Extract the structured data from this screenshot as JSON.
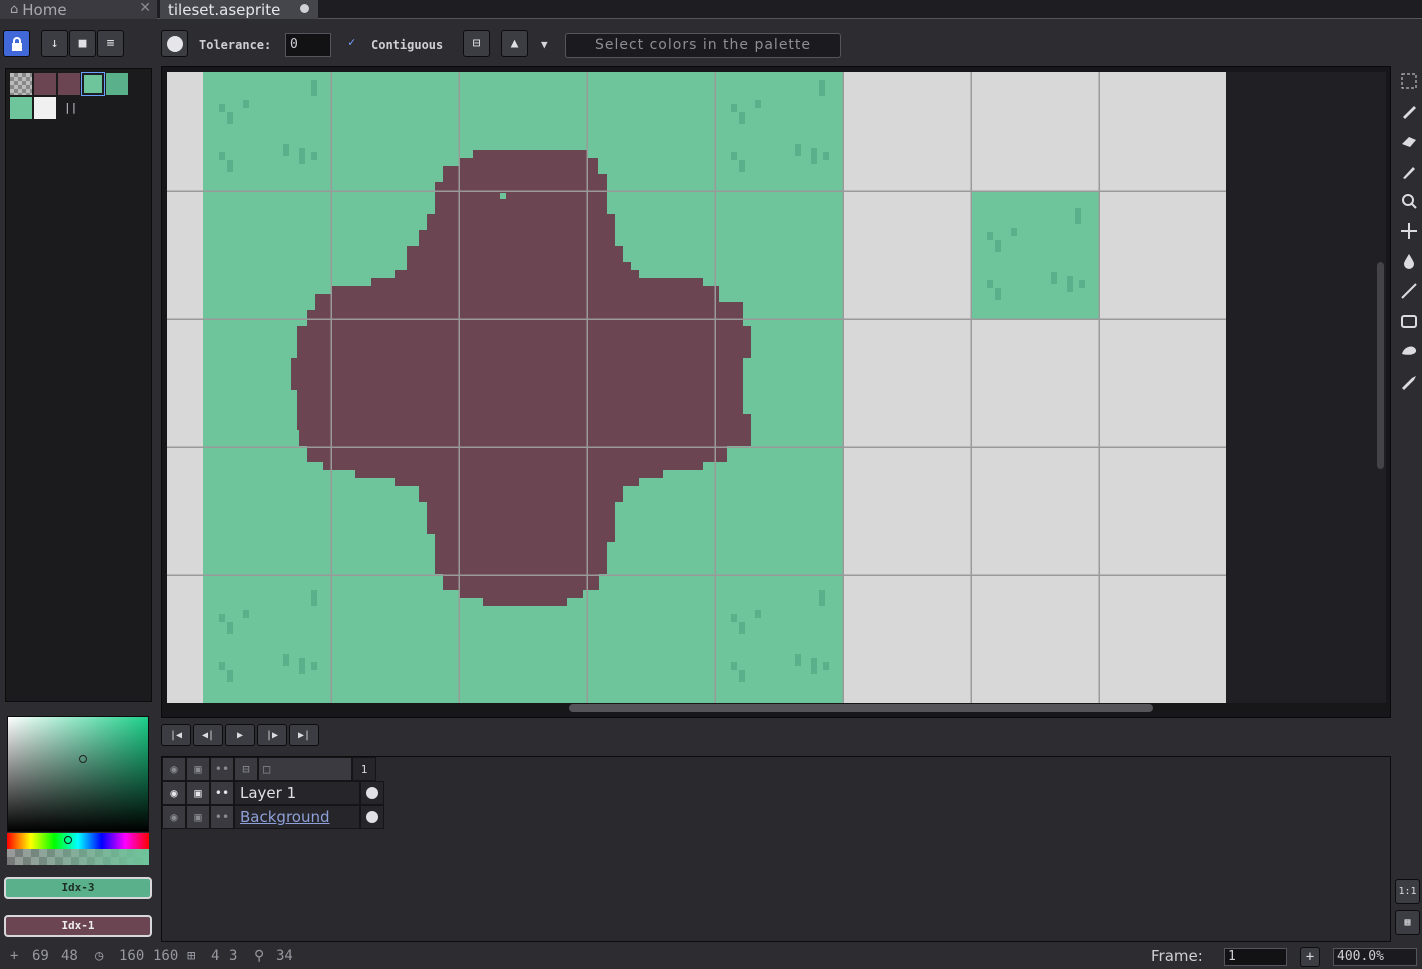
{
  "tabs": [
    {
      "label": "Home"
    },
    {
      "label": "tileset.aseprite"
    }
  ],
  "toolbar": {
    "tolerance_label": "Tolerance:",
    "tolerance_value": "0",
    "contiguous_label": "Contiguous",
    "contiguous_checked": true,
    "hint": "Select colors in the palette"
  },
  "palette": {
    "swatches": [
      "transparent",
      "#6b4652",
      "#6b4652",
      "#6ec49b",
      "#59b08a",
      "#6ec49b",
      "#f0f0f0"
    ],
    "selected_index": 3
  },
  "colors": {
    "fg_label": "Idx-3",
    "bg_label": "Idx-1",
    "grass": "#6ec49b",
    "grass_dark": "#59b08a",
    "dirt": "#6b4652",
    "empty_tile": "#d8d8d8",
    "grid": "#9a9a9a",
    "accent": "#4168d8"
  },
  "layers": {
    "frame_header": "1",
    "rows": [
      {
        "name": "Layer 1",
        "visible": true
      },
      {
        "name": "Background",
        "visible": true
      }
    ]
  },
  "status": {
    "cursor_x": "69",
    "cursor_y": "48",
    "size_w": "160",
    "size_h": "160",
    "grid_c": "4",
    "grid_r": "3",
    "zoom_read": "34",
    "frame_label": "Frame:",
    "frame_value": "1",
    "zoom_value": "400.0%"
  }
}
